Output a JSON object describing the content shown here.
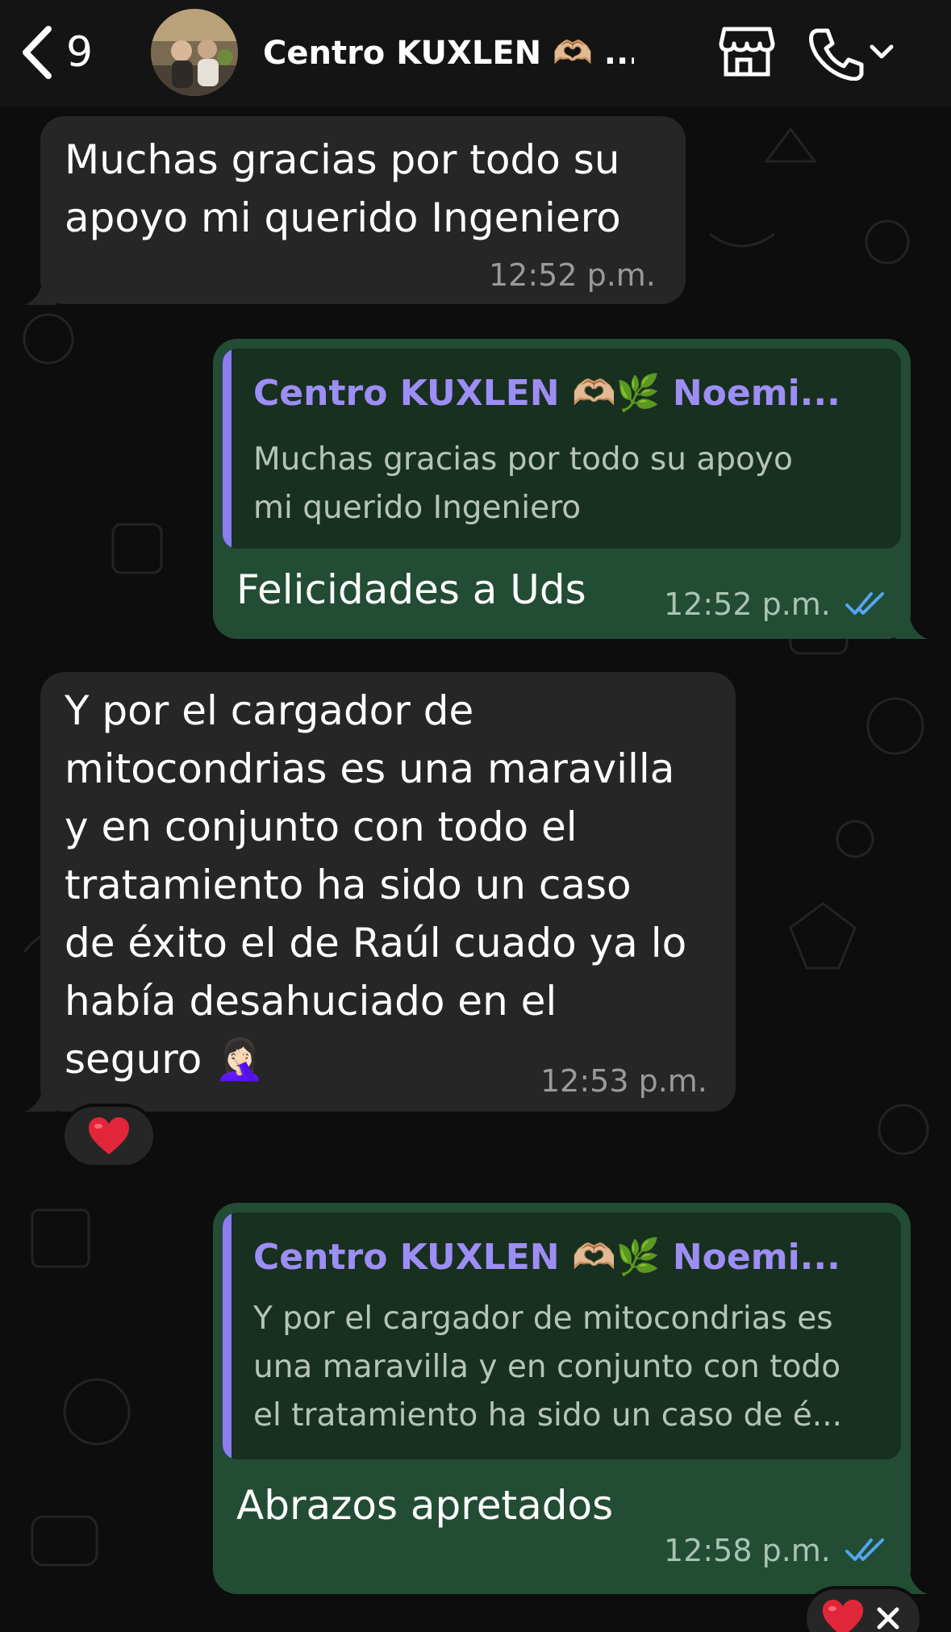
{
  "header": {
    "back_count": "9",
    "contact_name": "Centro KUXLEN 🫶🏼 ..."
  },
  "messages": [
    {
      "id": "m1",
      "direction": "incoming",
      "lines": [
        "Muchas gracias por todo su",
        "apoyo mi querido Ingeniero"
      ],
      "time": "12:52 p.m."
    },
    {
      "id": "m2",
      "direction": "outgoing",
      "quote_author": "Centro KUXLEN 🫶🏼🌿 Noemi...",
      "quote_lines": [
        "Muchas gracias por todo su apoyo",
        "mi querido Ingeniero"
      ],
      "text": "Felicidades a Uds",
      "time": "12:52 p.m.",
      "status": "read"
    },
    {
      "id": "m3",
      "direction": "incoming",
      "lines": [
        "Y por el cargador de",
        "mitocondrias es una maravilla",
        "y en conjunto con todo el",
        "tratamiento ha sido un caso",
        "de éxito el de Raúl cuado ya lo",
        "había desahuciado en el",
        "seguro 🤦🏻‍♀️"
      ],
      "time": "12:53 p.m.",
      "reaction": "heart"
    },
    {
      "id": "m4",
      "direction": "outgoing",
      "quote_author": "Centro KUXLEN 🫶🏼🌿 Noemi...",
      "quote_lines": [
        "Y por el cargador de mitocondrias es",
        "una maravilla y en conjunto con todo",
        "el tratamiento ha sido un caso de é..."
      ],
      "text": "Abrazos apretados",
      "time": "12:58 p.m.",
      "status": "read",
      "reaction": "heart"
    }
  ],
  "colors": {
    "incoming_bubble": "#262626",
    "outgoing_bubble": "#234c35",
    "quote_accent": "#8e7cf2",
    "read_ticks": "#53a6ef",
    "heart": "#e2263a"
  }
}
